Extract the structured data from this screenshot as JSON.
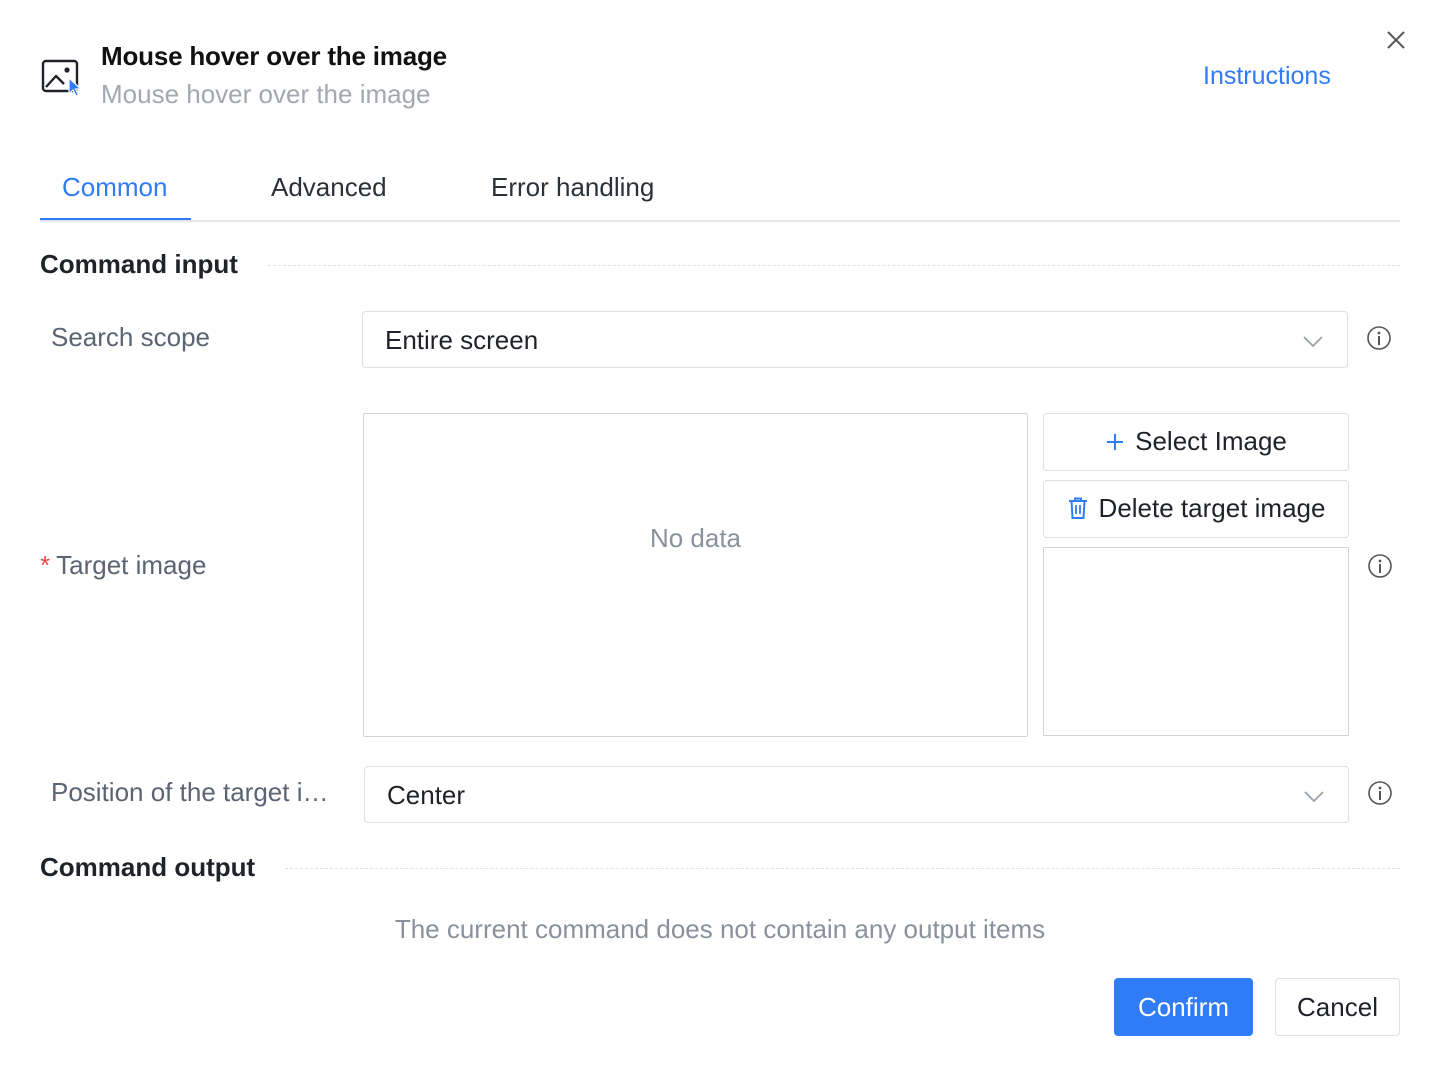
{
  "header": {
    "title": "Mouse hover over the image",
    "subtitle": "Mouse hover over the image",
    "icon": "image-cursor-icon",
    "instructions_link": "Instructions",
    "close_icon": "close-icon"
  },
  "tabs": [
    {
      "label": "Common",
      "active": true
    },
    {
      "label": "Advanced",
      "active": false
    },
    {
      "label": "Error handling",
      "active": false
    }
  ],
  "command_input": {
    "title": "Command input",
    "search_scope": {
      "label": "Search scope",
      "value": "Entire screen"
    },
    "target_image": {
      "label": "Target image",
      "required_mark": "*",
      "empty_text": "No data",
      "select_button": "Select Image",
      "delete_button": "Delete target image"
    },
    "position": {
      "label": "Position of the target i…",
      "value": "Center"
    }
  },
  "command_output": {
    "title": "Command output",
    "empty_text": "The current command does not contain any output items"
  },
  "footer": {
    "confirm": "Confirm",
    "cancel": "Cancel"
  },
  "colors": {
    "accent": "#2f7cf6",
    "required": "#f04848",
    "muted_text": "#8a919c"
  }
}
